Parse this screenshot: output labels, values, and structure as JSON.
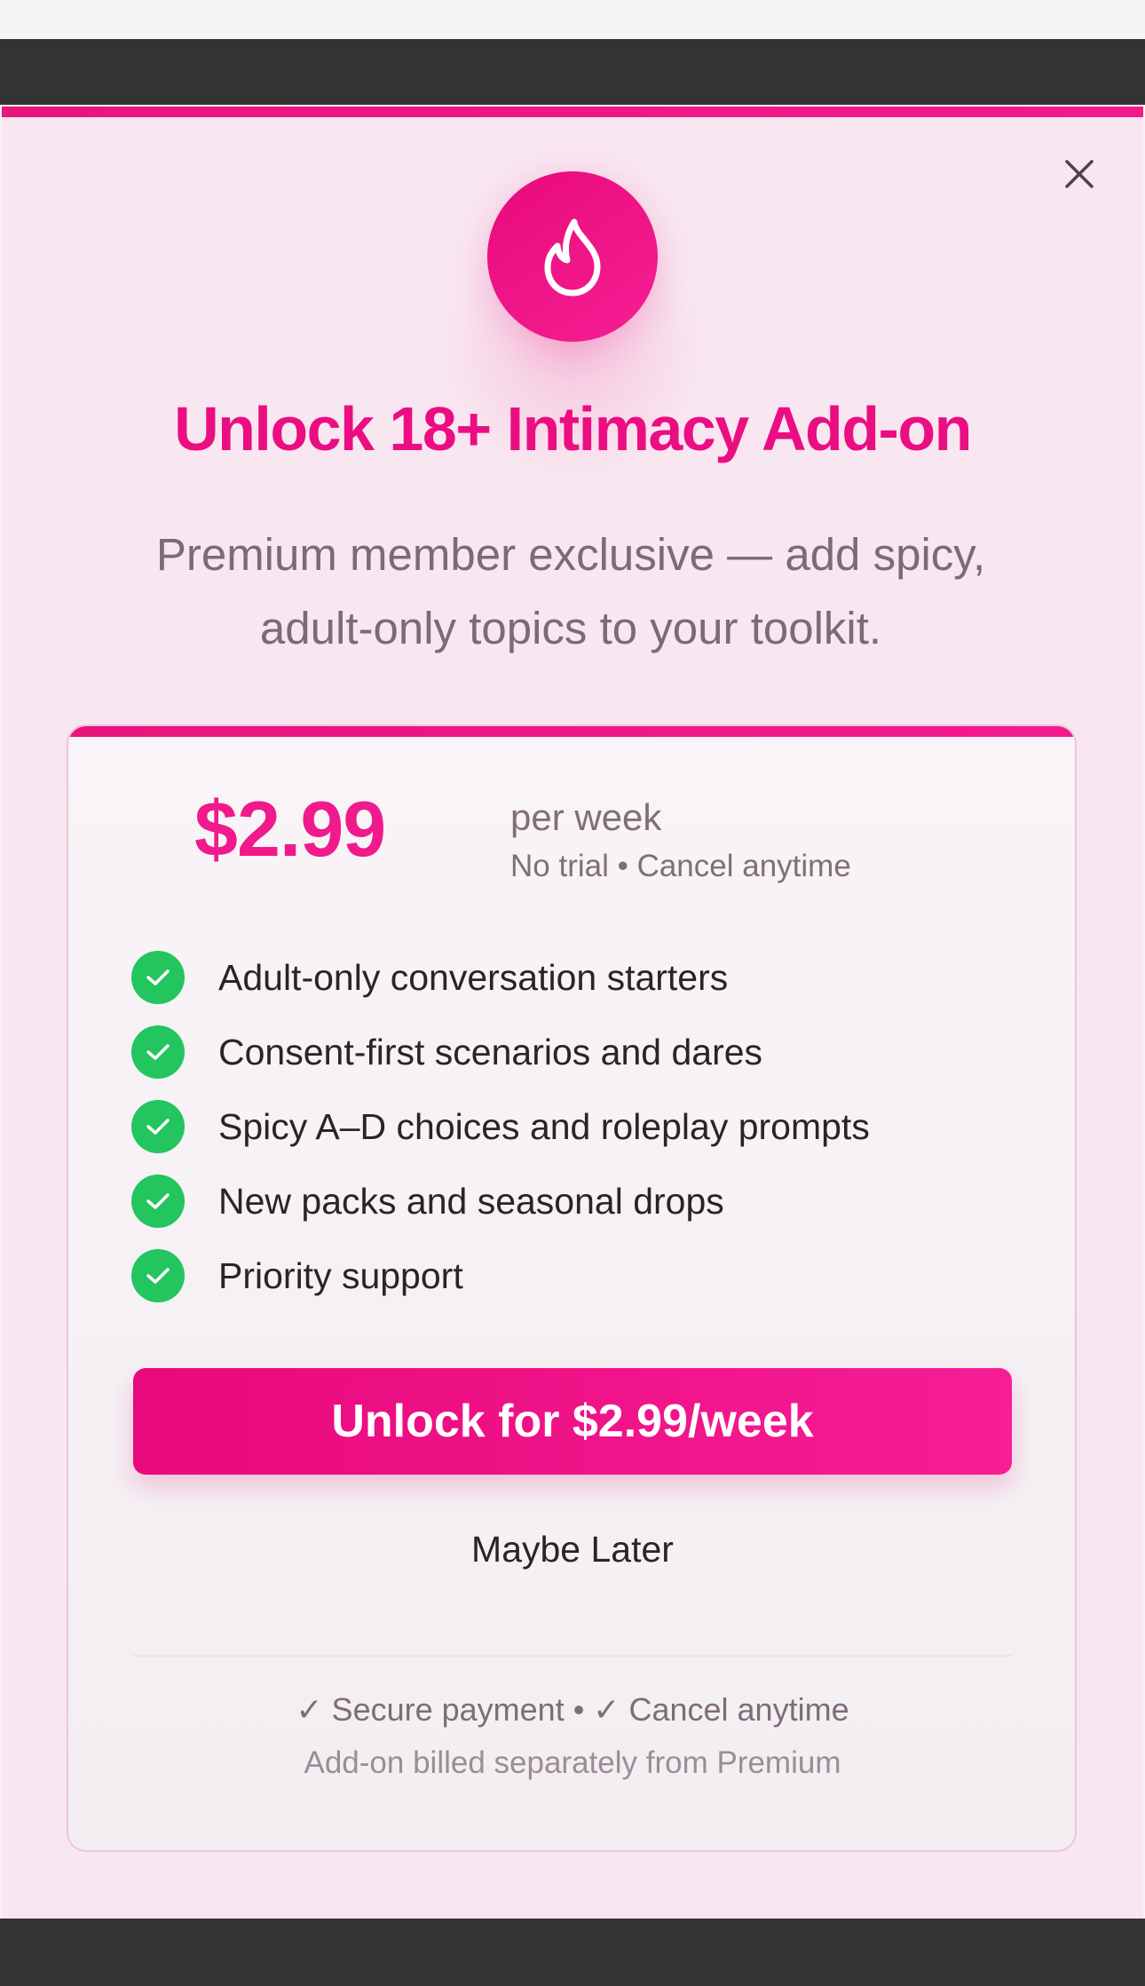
{
  "modal": {
    "title": "Unlock 18+ Intimacy Add-on",
    "subtitle_line1": "Premium member exclusive — add spicy,",
    "subtitle_line2": "adult-only topics to your toolkit.",
    "close_icon": "close-icon",
    "hero_icon": "flame-icon"
  },
  "pricing": {
    "price": "$2.99",
    "period": "per week",
    "note": "No trial • Cancel anytime"
  },
  "features": [
    "Adult-only conversation starters",
    "Consent-first scenarios and dares",
    "Spicy A–D choices and roleplay prompts",
    "New packs and seasonal drops",
    "Priority support"
  ],
  "actions": {
    "cta_label": "Unlock for $2.99/week",
    "secondary_label": "Maybe Later"
  },
  "footer": {
    "line1": "✓ Secure payment • ✓ Cancel anytime",
    "line2": "Add-on billed separately from Premium"
  },
  "colors": {
    "accent": "#ec1184",
    "success": "#22c55e",
    "background": "#f8e6f0"
  }
}
